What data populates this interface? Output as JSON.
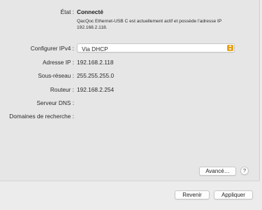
{
  "status": {
    "label": "État :",
    "value": "Connecté",
    "description": "QacQoc Ethernet-USB C est actuellement actif et possède l'adresse IP 192.168.2.118."
  },
  "configure_ipv4": {
    "label": "Configurer IPv4 :",
    "selected": "Via DHCP"
  },
  "fields": {
    "ip": {
      "label": "Adresse IP :",
      "value": "192.168.2.118"
    },
    "subnet": {
      "label": "Sous-réseau :",
      "value": "255.255.255.0"
    },
    "router": {
      "label": "Routeur :",
      "value": "192.168.2.254"
    },
    "dns": {
      "label": "Serveur DNS :",
      "value": ""
    },
    "search_domains": {
      "label": "Domaines de recherche :",
      "value": ""
    }
  },
  "buttons": {
    "advanced": "Avancé…",
    "help": "?",
    "revert": "Revenir",
    "apply": "Appliquer"
  },
  "colors": {
    "select_arrow": "#e8a317"
  }
}
